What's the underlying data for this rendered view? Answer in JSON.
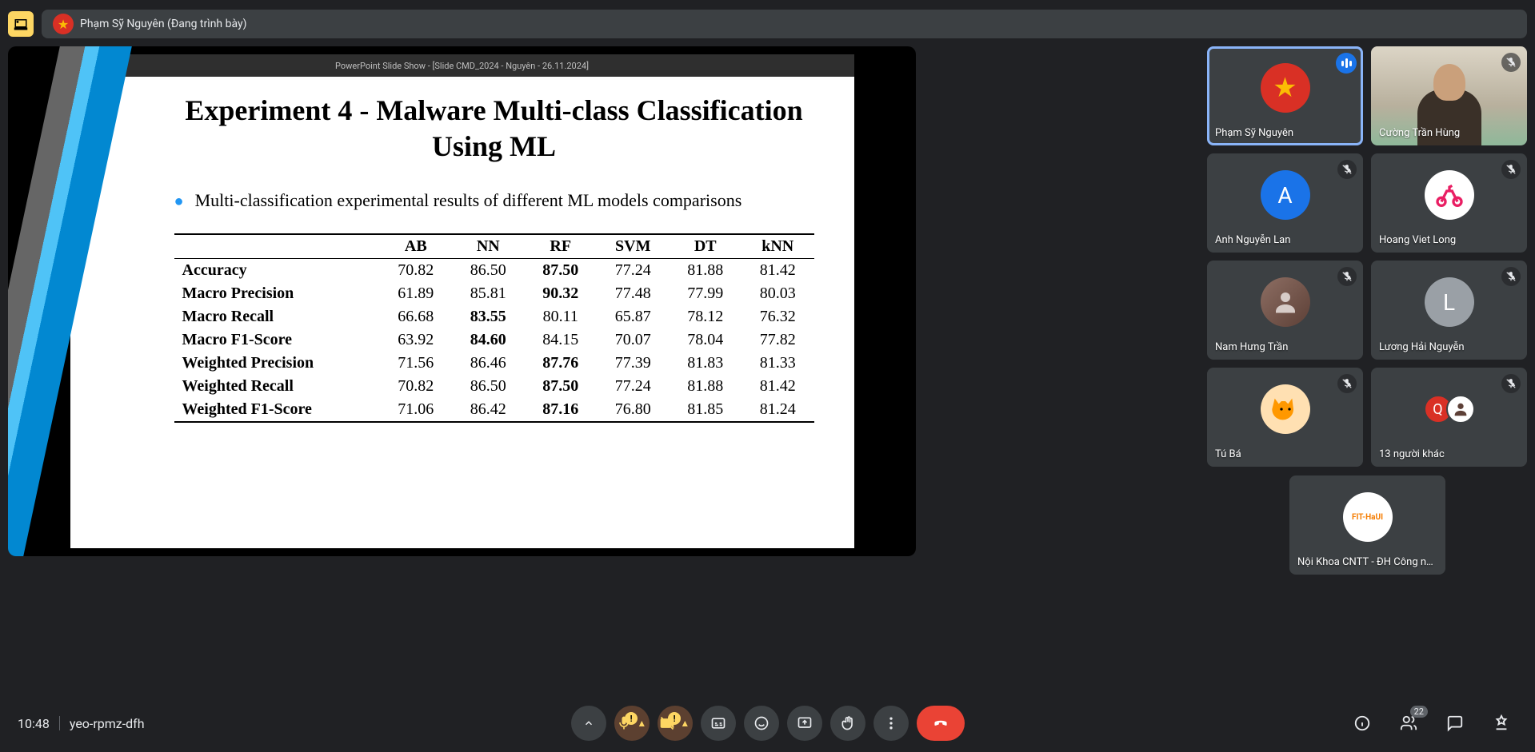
{
  "topbar": {
    "presenter_label": "Phạm Sỹ Nguyên (Đang trình bày)"
  },
  "slide": {
    "window_title": "PowerPoint Slide Show - [Slide CMD_2024 - Nguyên - 26.11.2024]",
    "title_line1": "Experiment 4 - Malware Multi-class Classification",
    "title_line2": "Using ML",
    "bullet": "Multi-classification experimental results of different ML models comparisons"
  },
  "chart_data": {
    "type": "table",
    "columns": [
      "",
      "AB",
      "NN",
      "RF",
      "SVM",
      "DT",
      "kNN"
    ],
    "rows": [
      {
        "label": "Accuracy",
        "values": [
          "70.82",
          "86.50",
          "87.50",
          "77.24",
          "81.88",
          "81.42"
        ],
        "bold_idx": [
          2
        ]
      },
      {
        "label": "Macro Precision",
        "values": [
          "61.89",
          "85.81",
          "90.32",
          "77.48",
          "77.99",
          "80.03"
        ],
        "bold_idx": [
          2
        ]
      },
      {
        "label": "Macro Recall",
        "values": [
          "66.68",
          "83.55",
          "80.11",
          "65.87",
          "78.12",
          "76.32"
        ],
        "bold_idx": [
          1
        ]
      },
      {
        "label": "Macro F1-Score",
        "values": [
          "63.92",
          "84.60",
          "84.15",
          "70.07",
          "78.04",
          "77.82"
        ],
        "bold_idx": [
          1
        ]
      },
      {
        "label": "Weighted Precision",
        "values": [
          "71.56",
          "86.46",
          "87.76",
          "77.39",
          "81.83",
          "81.33"
        ],
        "bold_idx": [
          2
        ]
      },
      {
        "label": "Weighted Recall",
        "values": [
          "70.82",
          "86.50",
          "87.50",
          "77.24",
          "81.88",
          "81.42"
        ],
        "bold_idx": [
          2
        ]
      },
      {
        "label": "Weighted F1-Score",
        "values": [
          "71.06",
          "86.42",
          "87.16",
          "76.80",
          "81.85",
          "81.24"
        ],
        "bold_idx": [
          2
        ]
      }
    ]
  },
  "participants": [
    {
      "name": "Phạm Sỹ Nguyên",
      "avatar_type": "star",
      "status": "speaking",
      "active": true
    },
    {
      "name": "Cường Trần Hùng",
      "avatar_type": "camera",
      "status": "muted"
    },
    {
      "name": "Anh Nguyễn Lan",
      "avatar_type": "letter",
      "letter": "A",
      "color": "#1a73e8",
      "status": "muted"
    },
    {
      "name": "Hoang Viet Long",
      "avatar_type": "bike",
      "status": "muted"
    },
    {
      "name": "Nam Hưng Trần",
      "avatar_type": "photo",
      "status": "muted"
    },
    {
      "name": "Lương Hải Nguyễn",
      "avatar_type": "letter",
      "letter": "L",
      "color": "#9aa0a6",
      "status": "muted"
    },
    {
      "name": "Tú Bá",
      "avatar_type": "cat",
      "status": "muted"
    },
    {
      "name": "13 người khác",
      "avatar_type": "multi",
      "status": "muted"
    }
  ],
  "extra_participant": {
    "name": "Nội Khoa CNTT - ĐH Công ng…",
    "avatar_type": "logo"
  },
  "bottom": {
    "time": "10:48",
    "code": "yeo-rpmz-dfh",
    "participant_count": "22"
  }
}
